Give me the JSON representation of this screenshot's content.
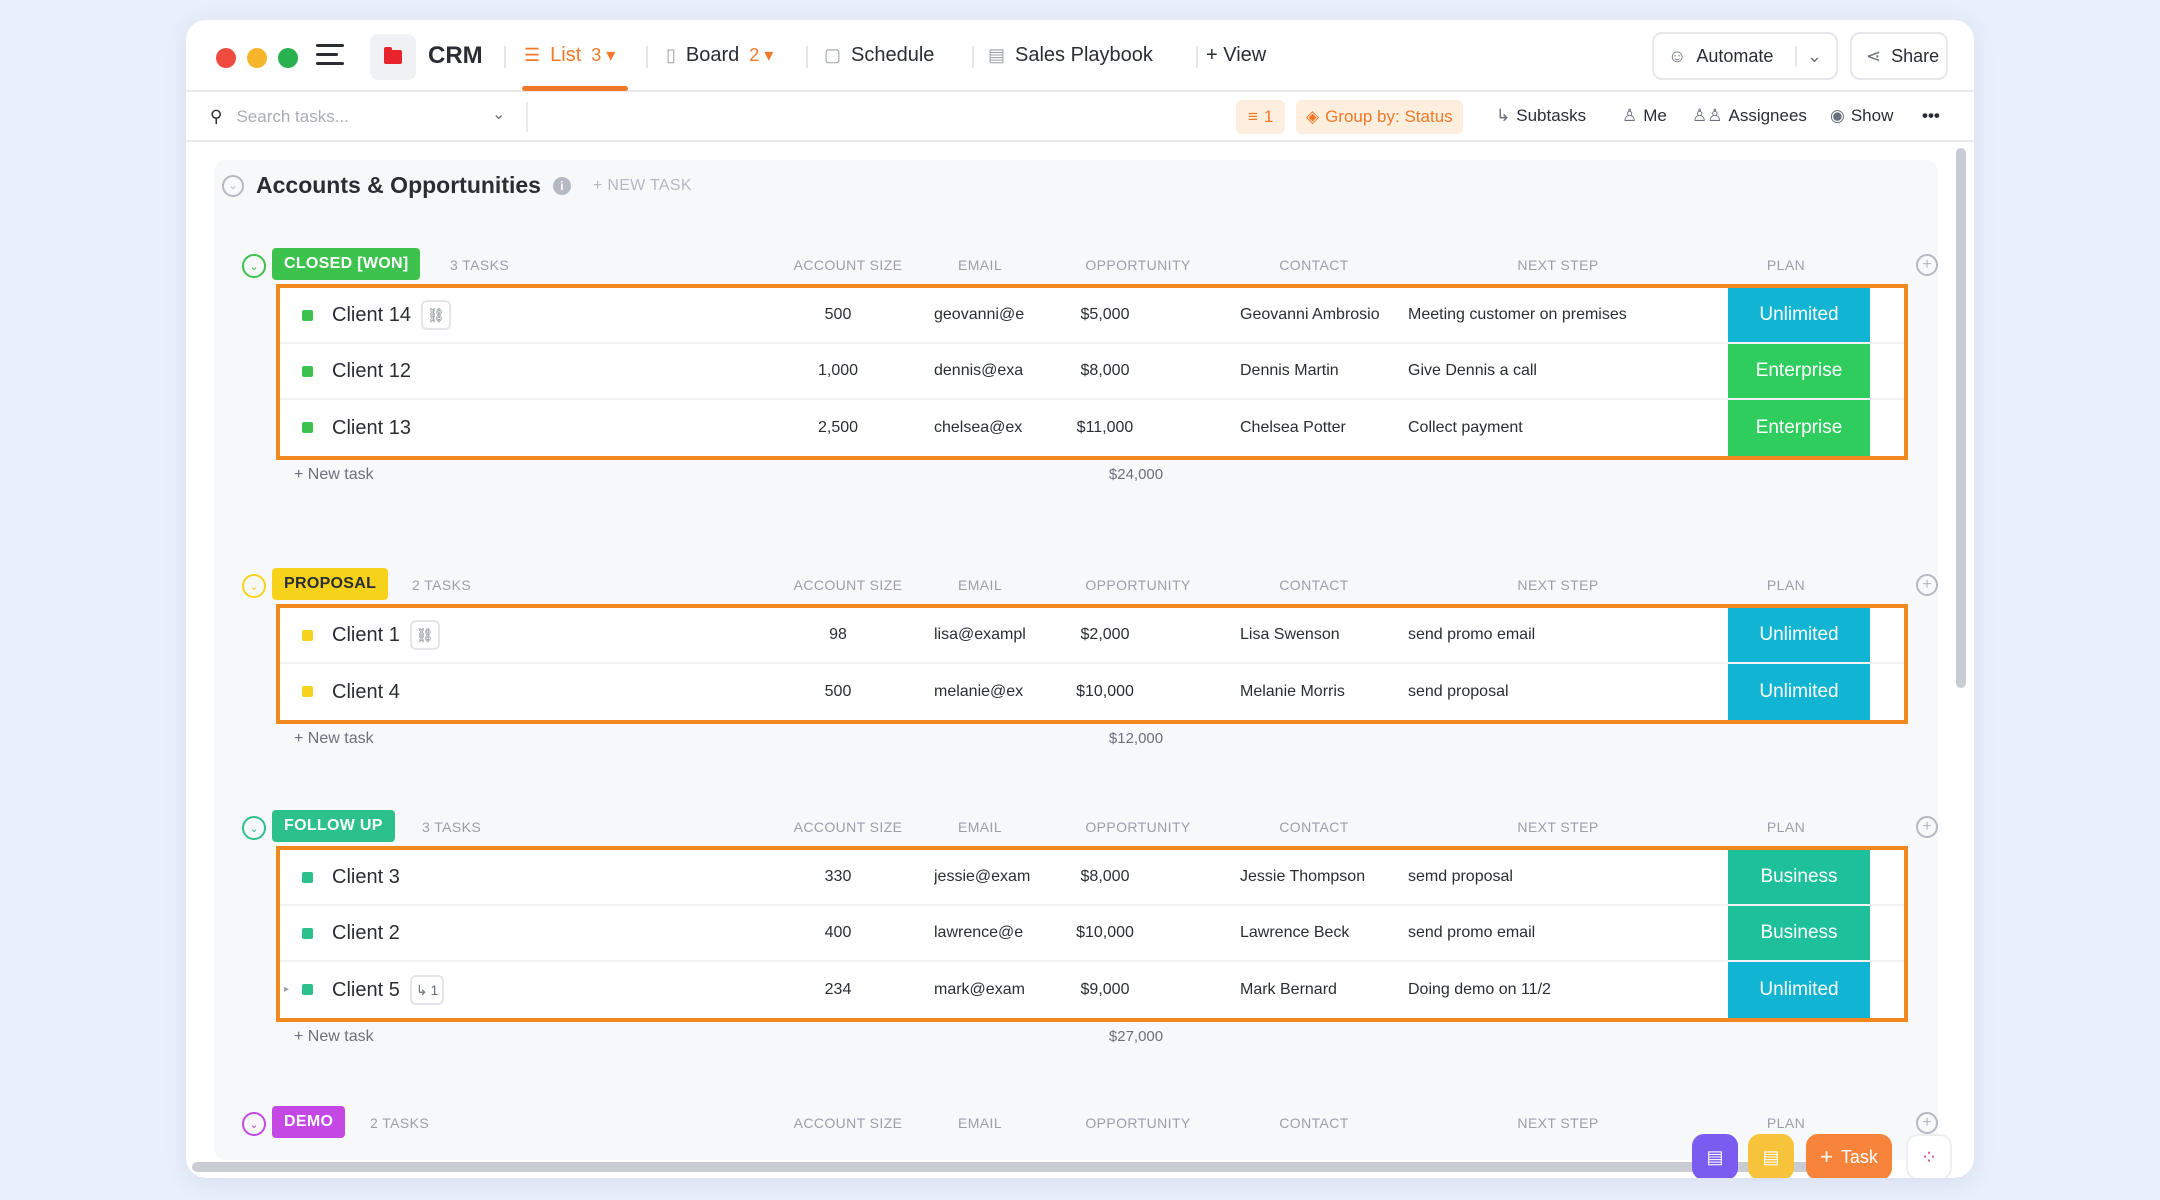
{
  "header": {
    "space_title": "CRM",
    "tabs": [
      {
        "label": "List",
        "count": "3",
        "active": true
      },
      {
        "label": "Board",
        "count": "2"
      },
      {
        "label": "Schedule"
      },
      {
        "label": "Sales Playbook"
      },
      {
        "label": "+ View"
      }
    ],
    "automate_label": "Automate",
    "share_label": "Share"
  },
  "toolbar": {
    "search_placeholder": "Search tasks...",
    "filter_count": "1",
    "group_by_label": "Group by: Status",
    "subtasks_label": "Subtasks",
    "me_label": "Me",
    "assignees_label": "Assignees",
    "show_label": "Show"
  },
  "list": {
    "title": "Accounts & Opportunities",
    "new_task_label": "+ NEW TASK",
    "columns": [
      "ACCOUNT SIZE",
      "EMAIL",
      "OPPORTUNITY",
      "CONTACT",
      "NEXT STEP",
      "PLAN"
    ],
    "row_new_task_label": "+ New task"
  },
  "colors": {
    "accent": "#f2782a",
    "highlight_border": "#f2871f",
    "closed_won": "#3cc24d",
    "proposal": "#f7d21b",
    "follow_up": "#2cc08a",
    "demo": "#c348e4",
    "plan_unlimited": "#12b4d3",
    "plan_enterprise": "#2ecd5e",
    "plan_business": "#1dc09a"
  },
  "groups": [
    {
      "status": "CLOSED [WON]",
      "task_count": "3 TASKS",
      "total": "$24,000",
      "tasks": [
        {
          "name": "Client 14",
          "chip": "link",
          "account_size": "500",
          "email": "geovanni@e",
          "opportunity": "$5,000",
          "contact": "Geovanni Ambrosio",
          "next_step": "Meeting customer on premises",
          "plan": "Unlimited"
        },
        {
          "name": "Client 12",
          "account_size": "1,000",
          "email": "dennis@exa",
          "opportunity": "$8,000",
          "contact": "Dennis Martin",
          "next_step": "Give Dennis a call",
          "plan": "Enterprise"
        },
        {
          "name": "Client 13",
          "account_size": "2,500",
          "email": "chelsea@ex",
          "opportunity": "$11,000",
          "contact": "Chelsea Potter",
          "next_step": "Collect payment",
          "plan": "Enterprise"
        }
      ]
    },
    {
      "status": "PROPOSAL",
      "task_count": "2 TASKS",
      "total": "$12,000",
      "tasks": [
        {
          "name": "Client 1",
          "chip": "link",
          "account_size": "98",
          "email": "lisa@exampl",
          "opportunity": "$2,000",
          "contact": "Lisa Swenson",
          "next_step": "send promo email",
          "plan": "Unlimited"
        },
        {
          "name": "Client 4",
          "account_size": "500",
          "email": "melanie@ex",
          "opportunity": "$10,000",
          "contact": "Melanie Morris",
          "next_step": "send proposal",
          "plan": "Unlimited"
        }
      ]
    },
    {
      "status": "FOLLOW UP",
      "task_count": "3 TASKS",
      "total": "$27,000",
      "tasks": [
        {
          "name": "Client 3",
          "account_size": "330",
          "email": "jessie@exam",
          "opportunity": "$8,000",
          "contact": "Jessie Thompson",
          "next_step": "semd proposal",
          "plan": "Business"
        },
        {
          "name": "Client 2",
          "account_size": "400",
          "email": "lawrence@e",
          "opportunity": "$10,000",
          "contact": "Lawrence Beck",
          "next_step": "send promo email",
          "plan": "Business"
        },
        {
          "name": "Client 5",
          "chip": "subtasks",
          "chip_count": "1",
          "account_size": "234",
          "email": "mark@exam",
          "opportunity": "$9,000",
          "contact": "Mark Bernard",
          "next_step": "Doing demo on 11/2",
          "plan": "Unlimited"
        }
      ]
    },
    {
      "status": "DEMO",
      "task_count": "2 TASKS"
    }
  ],
  "fab": {
    "task_label": "Task"
  }
}
